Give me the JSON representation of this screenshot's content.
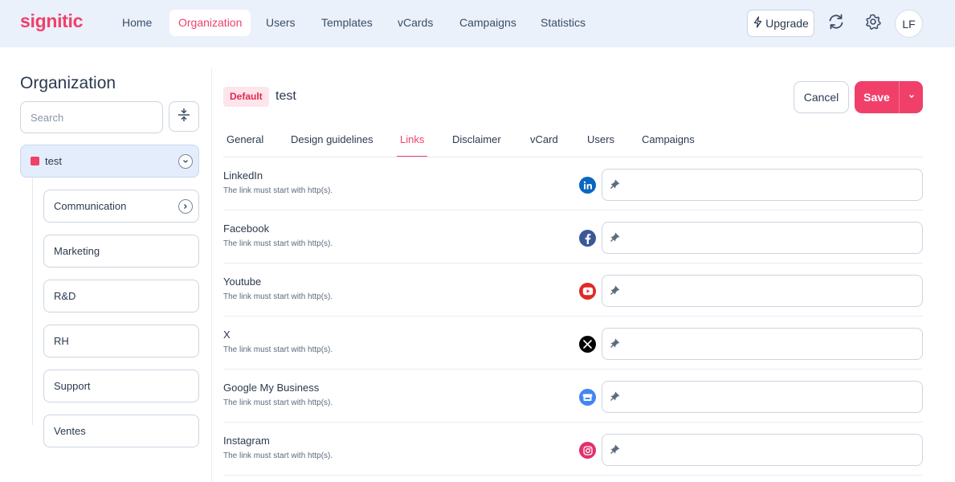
{
  "header": {
    "logo": "signitic",
    "nav": [
      {
        "label": "Home",
        "active": false
      },
      {
        "label": "Organization",
        "active": true
      },
      {
        "label": "Users",
        "active": false
      },
      {
        "label": "Templates",
        "active": false
      },
      {
        "label": "vCards",
        "active": false
      },
      {
        "label": "Campaigns",
        "active": false
      },
      {
        "label": "Statistics",
        "active": false
      }
    ],
    "upgrade_label": "Upgrade",
    "avatar_initials": "LF"
  },
  "sidebar": {
    "title": "Organization",
    "search_placeholder": "Search",
    "root": {
      "label": "test",
      "color": "#f0406a"
    },
    "children": [
      {
        "label": "Communication"
      },
      {
        "label": "Marketing"
      },
      {
        "label": "R&D"
      },
      {
        "label": "RH"
      },
      {
        "label": "Support"
      },
      {
        "label": "Ventes"
      }
    ]
  },
  "main": {
    "badge": "Default",
    "title": "test",
    "cancel_label": "Cancel",
    "save_label": "Save",
    "tabs": [
      {
        "label": "General",
        "active": false
      },
      {
        "label": "Design guidelines",
        "active": false
      },
      {
        "label": "Links",
        "active": true
      },
      {
        "label": "Disclaimer",
        "active": false
      },
      {
        "label": "vCard",
        "active": false
      },
      {
        "label": "Users",
        "active": false
      },
      {
        "label": "Campaigns",
        "active": false
      }
    ],
    "links": [
      {
        "name": "LinkedIn",
        "help": "The link must start with http(s).",
        "icon": "linkedin-icon",
        "value": ""
      },
      {
        "name": "Facebook",
        "help": "The link must start with http(s).",
        "icon": "facebook-icon",
        "value": ""
      },
      {
        "name": "Youtube",
        "help": "The link must start with http(s).",
        "icon": "youtube-icon",
        "value": ""
      },
      {
        "name": "X",
        "help": "The link must start with http(s).",
        "icon": "x-icon",
        "value": ""
      },
      {
        "name": "Google My Business",
        "help": "The link must start with http(s).",
        "icon": "google-my-business-icon",
        "value": ""
      },
      {
        "name": "Instagram",
        "help": "The link must start with http(s).",
        "icon": "instagram-icon",
        "value": ""
      }
    ]
  },
  "colors": {
    "accent": "#f0406a",
    "topbar_bg": "#eaf1fb",
    "linkedin": "#0a66c2",
    "facebook": "#3b5998",
    "youtube": "#e02a24",
    "x": "#000000",
    "google_my_business": "#4285f4",
    "instagram": "#e1306c"
  }
}
